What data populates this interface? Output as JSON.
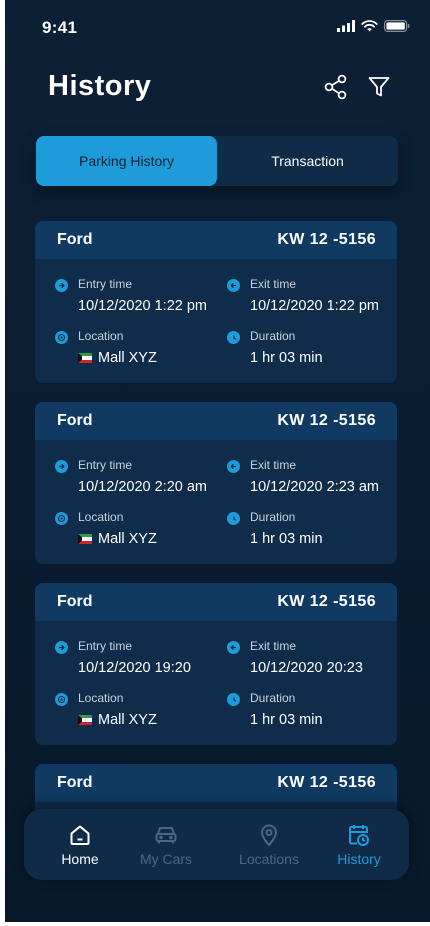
{
  "status_bar": {
    "time": "9:41"
  },
  "header": {
    "title": "History",
    "share_icon": "share-icon",
    "filter_icon": "filter-icon"
  },
  "segments": {
    "active_label": "Parking History",
    "inactive_label": "Transaction"
  },
  "labels": {
    "entry": "Entry time",
    "exit": "Exit time",
    "location": "Location",
    "duration": "Duration"
  },
  "records": [
    {
      "brand": "Ford",
      "plate": "KW 12 -5156",
      "entry": "10/12/2020 1:22 pm",
      "exit": "10/12/2020 1:22 pm",
      "location": "Mall XYZ",
      "duration": "1 hr 03 min"
    },
    {
      "brand": "Ford",
      "plate": "KW 12 -5156",
      "entry": "10/12/2020 2:20 am",
      "exit": "10/12/2020 2:23 am",
      "location": "Mall XYZ",
      "duration": "1 hr 03 min"
    },
    {
      "brand": "Ford",
      "plate": "KW 12 -5156",
      "entry": "10/12/2020 19:20",
      "exit": "10/12/2020 20:23",
      "location": "Mall XYZ",
      "duration": "1 hr 03 min"
    },
    {
      "brand": "Ford",
      "plate": "KW 12 -5156"
    }
  ],
  "tabbar": {
    "home": "Home",
    "cars": "My Cars",
    "locations": "Locations",
    "history": "History",
    "active": "History"
  },
  "colors": {
    "accent": "#1e9bd9",
    "background": "#0c2035",
    "card": "#0f2d4b",
    "card_header": "#103a62"
  }
}
